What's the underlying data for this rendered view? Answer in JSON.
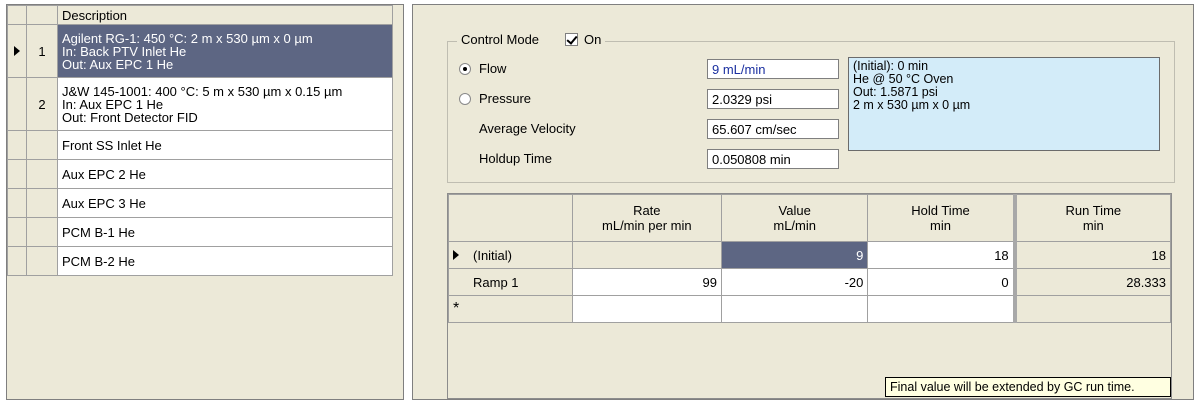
{
  "column_list": {
    "header": "Description",
    "rows": [
      {
        "num": "1",
        "selected": true,
        "lines": [
          "Agilent RG-1: 450 °C: 2 m x 530 µm x 0 µm",
          "In: Back PTV Inlet He",
          "Out: Aux EPC 1 He"
        ]
      },
      {
        "num": "2",
        "selected": false,
        "lines": [
          "J&W 145-1001: 400 °C: 5 m x 530 µm x 0.15 µm",
          "In: Aux EPC 1 He",
          "Out: Front Detector FID"
        ]
      },
      {
        "num": "",
        "selected": false,
        "lines": [
          "Front SS Inlet He"
        ]
      },
      {
        "num": "",
        "selected": false,
        "lines": [
          "Aux EPC 2 He"
        ]
      },
      {
        "num": "",
        "selected": false,
        "lines": [
          "Aux EPC 3 He"
        ]
      },
      {
        "num": "",
        "selected": false,
        "lines": [
          "PCM B-1 He"
        ]
      },
      {
        "num": "",
        "selected": false,
        "lines": [
          "PCM B-2 He"
        ]
      }
    ]
  },
  "control": {
    "mode_label": "Control Mode",
    "on_label": "On",
    "on_checked": true,
    "flow_label": "Flow",
    "flow_selected": true,
    "pressure_label": "Pressure",
    "avg_velocity_label": "Average Velocity",
    "holdup_label": "Holdup Time",
    "flow_value": "9 mL/min",
    "pressure_value": "2.0329 psi",
    "velocity_value": "65.607 cm/sec",
    "holdup_value": "0.050808 min",
    "info_lines": [
      "(Initial): 0 min",
      "He @ 50 °C Oven",
      "Out: 1.5871 psi",
      "2 m x 530 µm x 0 µm"
    ]
  },
  "ramp_table": {
    "headers": [
      {
        "title": "",
        "unit": ""
      },
      {
        "title": "Rate",
        "unit": "mL/min per min"
      },
      {
        "title": "Value",
        "unit": "mL/min"
      },
      {
        "title": "Hold Time",
        "unit": "min"
      },
      {
        "title": "Run Time",
        "unit": "min"
      }
    ],
    "rows": [
      {
        "label": "(Initial)",
        "rate": "",
        "value": "9",
        "hold": "18",
        "run": "18"
      },
      {
        "label": "Ramp 1",
        "rate": "99",
        "value": "-20",
        "hold": "0",
        "run": "28.333"
      }
    ],
    "new_row_marker": "*",
    "tooltip": "Final value will be extended by GC run time."
  }
}
